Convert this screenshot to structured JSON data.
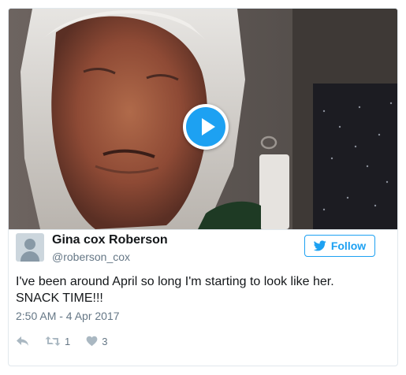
{
  "tweet": {
    "author_name": "Gina cox Roberson",
    "author_handle": "@roberson_cox",
    "follow_label": "Follow",
    "text_line1": "I've been around April so long I'm starting to look like her.",
    "text_line2": "SNACK TIME!!!",
    "timestamp": "2:50 AM - 4 Apr 2017",
    "retweet_count": "1",
    "like_count": "3"
  },
  "media": {
    "type": "video",
    "play_icon": "play-icon"
  },
  "icons": {
    "reply": "reply-icon",
    "retweet": "retweet-icon",
    "like": "heart-icon",
    "bird": "twitter-bird-icon",
    "avatar": "default-avatar-icon"
  },
  "colors": {
    "accent": "#1da1f2",
    "text": "#14171a",
    "muted": "#657786",
    "action": "#aab8c2",
    "border": "#e1e8ed"
  }
}
